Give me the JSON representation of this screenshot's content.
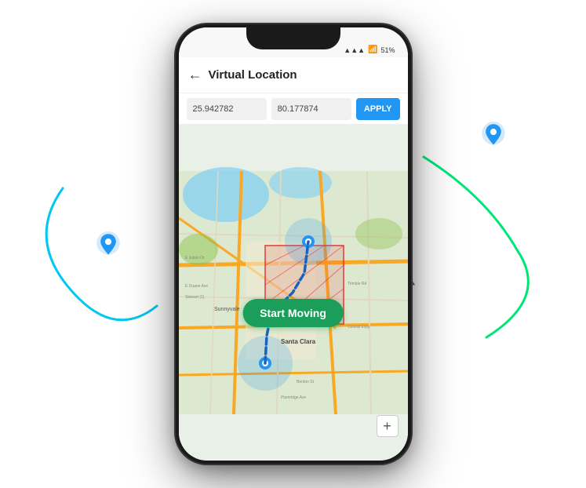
{
  "app": {
    "title": "Virtual Location",
    "back_label": "←",
    "status": {
      "signal": "▲▲▲",
      "wifi": "WiFi",
      "battery": "51%"
    }
  },
  "coord_bar": {
    "lat_value": "25.942782",
    "lng_value": "80.177874",
    "apply_label": "APPLY"
  },
  "map": {
    "route_color": "#1565C0",
    "zone_color": "#e53935",
    "zone_fill": "rgba(229,57,53,0.2)",
    "circle_color": "rgba(33,150,243,0.25)",
    "road_color": "#f9a825",
    "bg_color": "#e8ede8"
  },
  "button": {
    "start_moving_label": "Start Moving"
  },
  "zoom": {
    "plus_label": "+"
  },
  "arcs": {
    "left_color": "#00c8f0",
    "right_color": "#00e676"
  },
  "pins": {
    "left_color": "#2196F3",
    "right_color": "#2196F3"
  }
}
